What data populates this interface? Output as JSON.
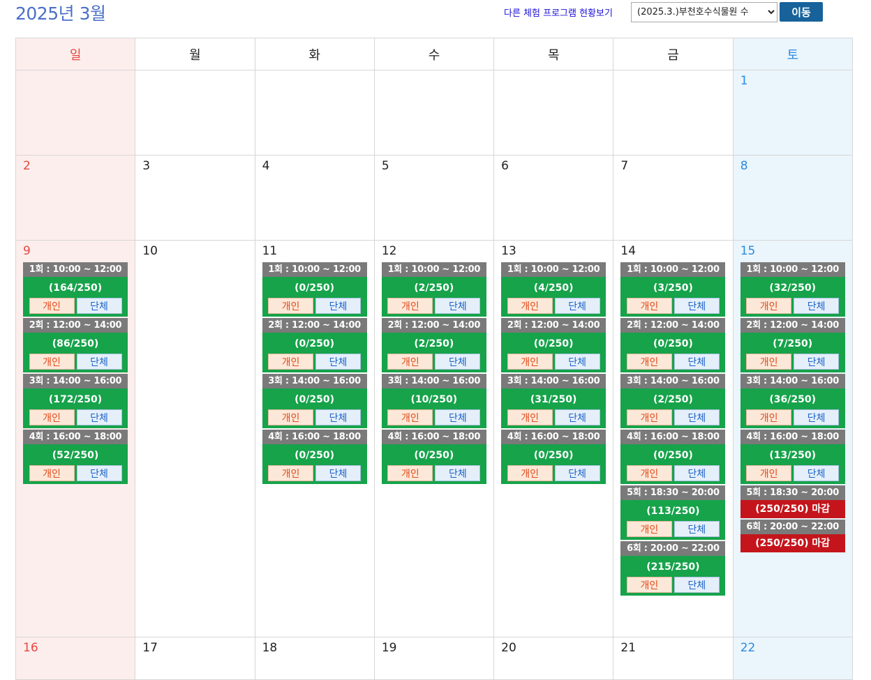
{
  "header": {
    "title": "2025년 3월",
    "other_programs_link": "다른 체험 프로그램 현황보기",
    "program_select_value": "(2025.3.)부천호수식물원 수",
    "go_button": "이동"
  },
  "weekdays": [
    "일",
    "월",
    "화",
    "수",
    "목",
    "금",
    "토"
  ],
  "week1": [
    "",
    "",
    "",
    "",
    "",
    "",
    "1"
  ],
  "week2": [
    "2",
    "3",
    "4",
    "5",
    "6",
    "7",
    "8"
  ],
  "week3": {
    "dates": [
      "9",
      "10",
      "11",
      "12",
      "13",
      "14",
      "15"
    ],
    "cells": [
      {
        "slots": [
          {
            "time": "1회 : 10:00 ~ 12:00",
            "count": "(164/250)"
          },
          {
            "time": "2회 : 12:00 ~ 14:00",
            "count": "(86/250)"
          },
          {
            "time": "3회 : 14:00 ~ 16:00",
            "count": "(172/250)"
          },
          {
            "time": "4회 : 16:00 ~ 18:00",
            "count": "(52/250)"
          }
        ]
      },
      {
        "slots": []
      },
      {
        "slots": [
          {
            "time": "1회 : 10:00 ~ 12:00",
            "count": "(0/250)"
          },
          {
            "time": "2회 : 12:00 ~ 14:00",
            "count": "(0/250)"
          },
          {
            "time": "3회 : 14:00 ~ 16:00",
            "count": "(0/250)"
          },
          {
            "time": "4회 : 16:00 ~ 18:00",
            "count": "(0/250)"
          }
        ]
      },
      {
        "slots": [
          {
            "time": "1회 : 10:00 ~ 12:00",
            "count": "(2/250)"
          },
          {
            "time": "2회 : 12:00 ~ 14:00",
            "count": "(2/250)"
          },
          {
            "time": "3회 : 14:00 ~ 16:00",
            "count": "(10/250)"
          },
          {
            "time": "4회 : 16:00 ~ 18:00",
            "count": "(0/250)"
          }
        ]
      },
      {
        "slots": [
          {
            "time": "1회 : 10:00 ~ 12:00",
            "count": "(4/250)"
          },
          {
            "time": "2회 : 12:00 ~ 14:00",
            "count": "(0/250)"
          },
          {
            "time": "3회 : 14:00 ~ 16:00",
            "count": "(31/250)"
          },
          {
            "time": "4회 : 16:00 ~ 18:00",
            "count": "(0/250)"
          }
        ]
      },
      {
        "slots": [
          {
            "time": "1회 : 10:00 ~ 12:00",
            "count": "(3/250)"
          },
          {
            "time": "2회 : 12:00 ~ 14:00",
            "count": "(0/250)"
          },
          {
            "time": "3회 : 14:00 ~ 16:00",
            "count": "(2/250)"
          },
          {
            "time": "4회 : 16:00 ~ 18:00",
            "count": "(0/250)"
          },
          {
            "time": "5회 : 18:30 ~ 20:00",
            "count": "(113/250)"
          },
          {
            "time": "6회 : 20:00 ~ 22:00",
            "count": "(215/250)"
          }
        ]
      },
      {
        "slots": [
          {
            "time": "1회 : 10:00 ~ 12:00",
            "count": "(32/250)"
          },
          {
            "time": "2회 : 12:00 ~ 14:00",
            "count": "(7/250)"
          },
          {
            "time": "3회 : 14:00 ~ 16:00",
            "count": "(36/250)"
          },
          {
            "time": "4회 : 16:00 ~ 18:00",
            "count": "(13/250)"
          },
          {
            "time": "5회 : 18:30 ~ 20:00",
            "count": "(250/250) 마감",
            "closed": true
          },
          {
            "time": "6회 : 20:00 ~ 22:00",
            "count": "(250/250) 마감",
            "closed": true
          }
        ]
      }
    ]
  },
  "week4": [
    "16",
    "17",
    "18",
    "19",
    "20",
    "21",
    "22"
  ],
  "labels": {
    "individual": "개인",
    "group": "단체"
  },
  "colors": {
    "slot_header": "#7a7a7a",
    "slot_open": "#16a34a",
    "slot_closed": "#c4151c",
    "sunday": "#e8473f",
    "saturday": "#2a8ae0"
  }
}
